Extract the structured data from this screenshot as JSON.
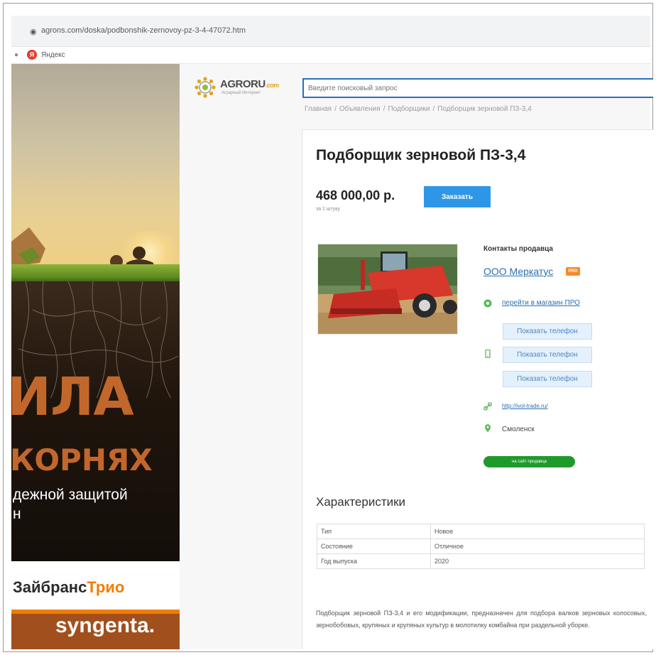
{
  "browser": {
    "url": "agrons.com/doska/podbonshik-zernovoy-pz-3-4-47072.htm",
    "bookmark_icon_letter": "Я",
    "bookmark_label": "Яндекс"
  },
  "banner": {
    "big_line1": "ИЛА",
    "big_line2": "КОРНЯХ",
    "line3": "дежной защитой",
    "line4": "н",
    "brand_a": "Зайбранс",
    "brand_b": "Трио",
    "partner": "syngenta."
  },
  "site": {
    "logo": "AGRORU",
    "logo_suffix": ".com",
    "logo_sub": "Аграрный Интернет",
    "search_placeholder": "Введите поисковый запрос"
  },
  "breadcrumb": [
    "Главная",
    "Объявления",
    "Подборщики",
    "Подборщик зерновой ПЗ-3,4"
  ],
  "product": {
    "title": "Подборщик зерновой ПЗ-3,4",
    "price": "468 000,00 р.",
    "price_unit": "за 1 штуку",
    "order_label": "Заказать"
  },
  "contacts": {
    "heading": "Контакты продавца",
    "seller": "ООО Меркатус",
    "seller_badge": "PRO",
    "company_link": "перейти в магазин ПРО",
    "phone_button": "Показать телефон",
    "website": "http://ivol-trade.ru/",
    "city": "Смоленск",
    "site_button": "на сайт продавца"
  },
  "characteristics": {
    "heading": "Характеристики",
    "rows": [
      {
        "key": "Тип",
        "value": "Новое"
      },
      {
        "key": "Состояние",
        "value": "Отличное"
      },
      {
        "key": "Год выпуска",
        "value": "2020"
      }
    ]
  },
  "description": "Подборщик зерновой ПЗ-3,4 и его модификации, предназначен для подбора валков зерновых колосовых, зернобобовых, крупяных и крупяных культур в молотилку комбайна при раздельной уборке.",
  "colors": {
    "accent": "#2e96e6",
    "link": "#2b6fb0",
    "green": "#1f9a2a",
    "banner_text": "#c2672b"
  }
}
